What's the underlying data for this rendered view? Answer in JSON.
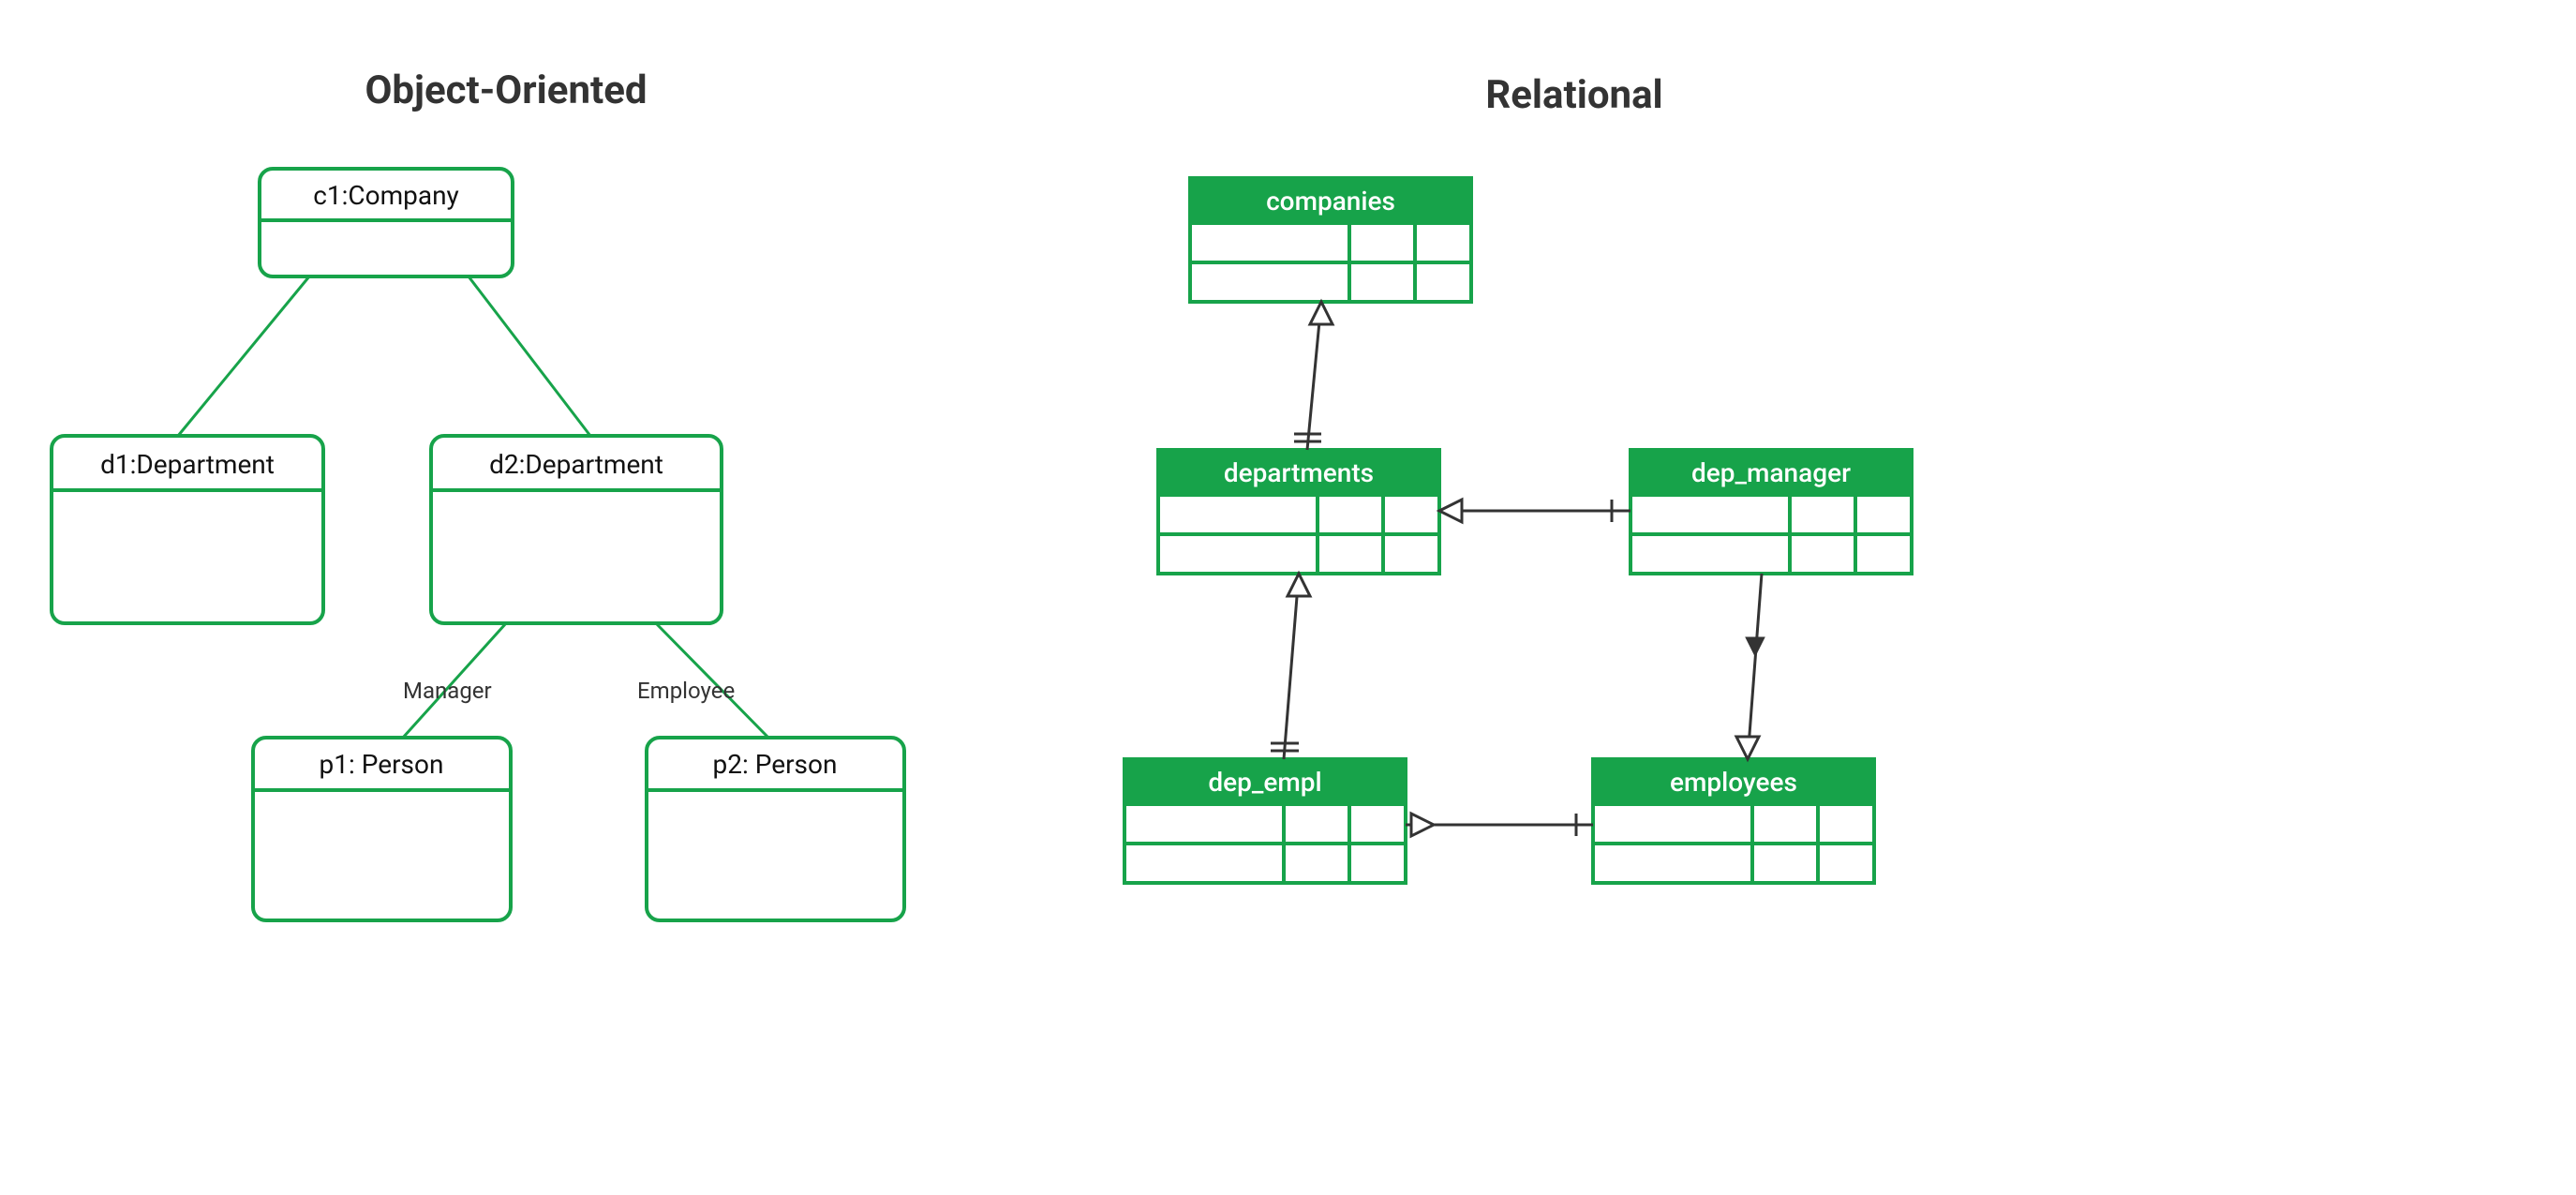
{
  "left": {
    "title": "Object-Oriented",
    "company": "c1:Company",
    "dept1": "d1:Department",
    "dept2": "d2:Department",
    "person1": "p1: Person",
    "person2": "p2: Person",
    "manager_label": "Manager",
    "employee_label": "Employee"
  },
  "right": {
    "title": "Relational",
    "companies": "companies",
    "departments": "departments",
    "dep_manager": "dep_manager",
    "dep_empl": "dep_empl",
    "employees": "employees"
  }
}
